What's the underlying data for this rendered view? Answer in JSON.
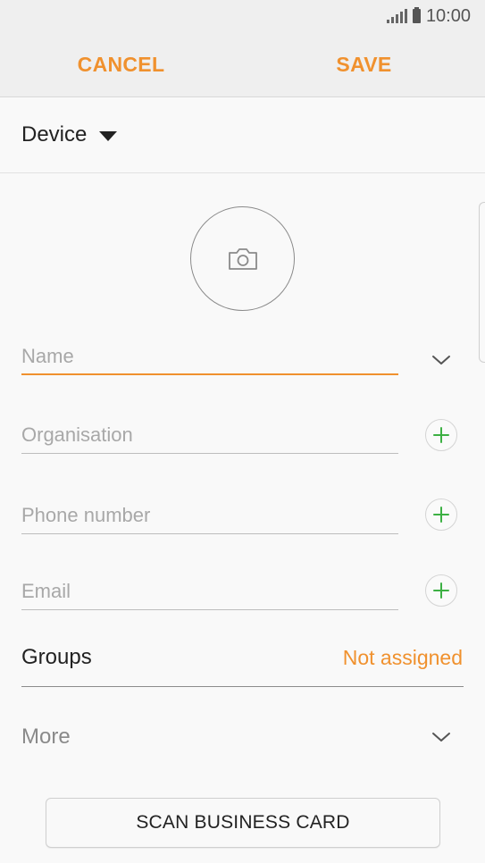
{
  "status_bar": {
    "time": "10:00",
    "icons": [
      "signal-icon",
      "battery-icon"
    ]
  },
  "action_bar": {
    "cancel_label": "CANCEL",
    "save_label": "SAVE"
  },
  "storage": {
    "selected": "Device"
  },
  "photo": {
    "icon": "camera-icon"
  },
  "fields": {
    "name": {
      "placeholder": "Name",
      "value": ""
    },
    "organisation": {
      "placeholder": "Organisation",
      "value": ""
    },
    "phone": {
      "placeholder": "Phone number",
      "value": ""
    },
    "email": {
      "placeholder": "Email",
      "value": ""
    }
  },
  "groups": {
    "label": "Groups",
    "value": "Not assigned"
  },
  "more": {
    "label": "More"
  },
  "scan_button": {
    "label": "SCAN BUSINESS CARD"
  },
  "colors": {
    "accent": "#f0912e",
    "add_green": "#3cb043",
    "background": "#f9f9f9",
    "action_bar": "#efefef"
  }
}
